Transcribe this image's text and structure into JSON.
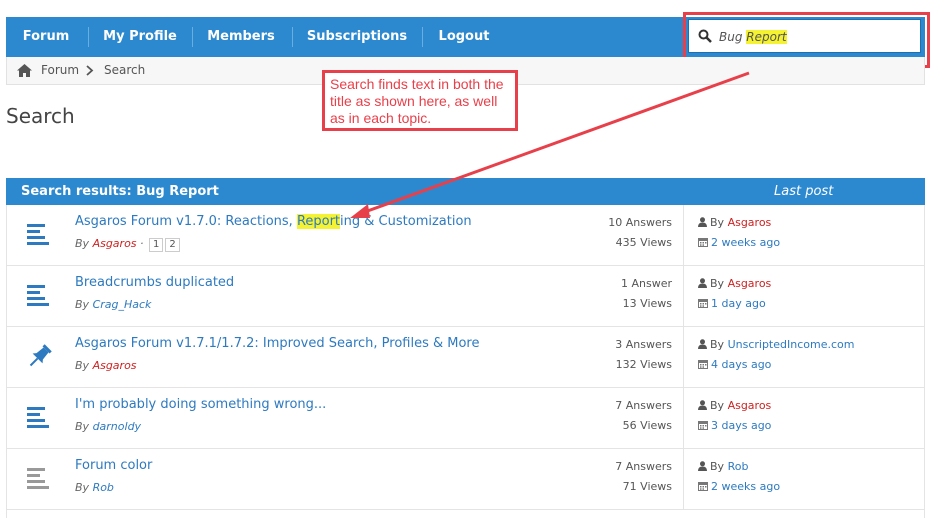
{
  "nav": {
    "items": [
      "Forum",
      "My Profile",
      "Members",
      "Subscriptions",
      "Logout"
    ]
  },
  "search": {
    "query_part1": "Bug ",
    "query_part2": "Report"
  },
  "breadcrumb": {
    "home": "Forum",
    "current": "Search"
  },
  "page_title": "Search",
  "callout": {
    "text": "Search finds text in both the title as shown here, as well as in each topic."
  },
  "results": {
    "header": "Search results: Bug Report",
    "last_post_label": "Last post",
    "by_label": "By",
    "topics": [
      {
        "title_pre": "Asgaros Forum v1.7.0: Reactions, ",
        "title_hl": "Report",
        "title_post": "ing & Customization",
        "author": "Asgaros",
        "pages": [
          "1",
          "2"
        ],
        "answers": "10 Answers",
        "views": "435 Views",
        "last_by": "Asgaros",
        "last_when": "2 weeks ago",
        "icon": "topic-lines-icon"
      },
      {
        "title_pre": "Breadcrumbs duplicated",
        "author": "Crag_Hack",
        "answers": "1 Answer",
        "views": "13 Views",
        "last_by": "Asgaros",
        "last_when": "1 day ago",
        "icon": "topic-lines-icon"
      },
      {
        "title_pre": "Asgaros Forum v1.7.1/1.7.2: Improved Search, Profiles & More",
        "author": "Asgaros",
        "answers": "3 Answers",
        "views": "132 Views",
        "last_by": "UnscriptedIncome.com",
        "last_when": "4 days ago",
        "icon": "pin-icon"
      },
      {
        "title_pre": "I'm probably doing something wrong...",
        "author": "darnoldy",
        "answers": "7 Answers",
        "views": "56 Views",
        "last_by": "Asgaros",
        "last_when": "3 days ago",
        "icon": "topic-lines-icon"
      },
      {
        "title_pre": "Forum color",
        "author": "Rob",
        "answers": "7 Answers",
        "views": "71 Views",
        "last_by": "Rob",
        "last_when": "2 weeks ago",
        "icon": "topic-lines-icon"
      }
    ]
  },
  "colors": {
    "nav_bg": "#2d89cf",
    "link": "#2d7ac0",
    "annotation": "#e8404a",
    "highlight": "#f5f331",
    "author_admin": "#cc2222"
  }
}
